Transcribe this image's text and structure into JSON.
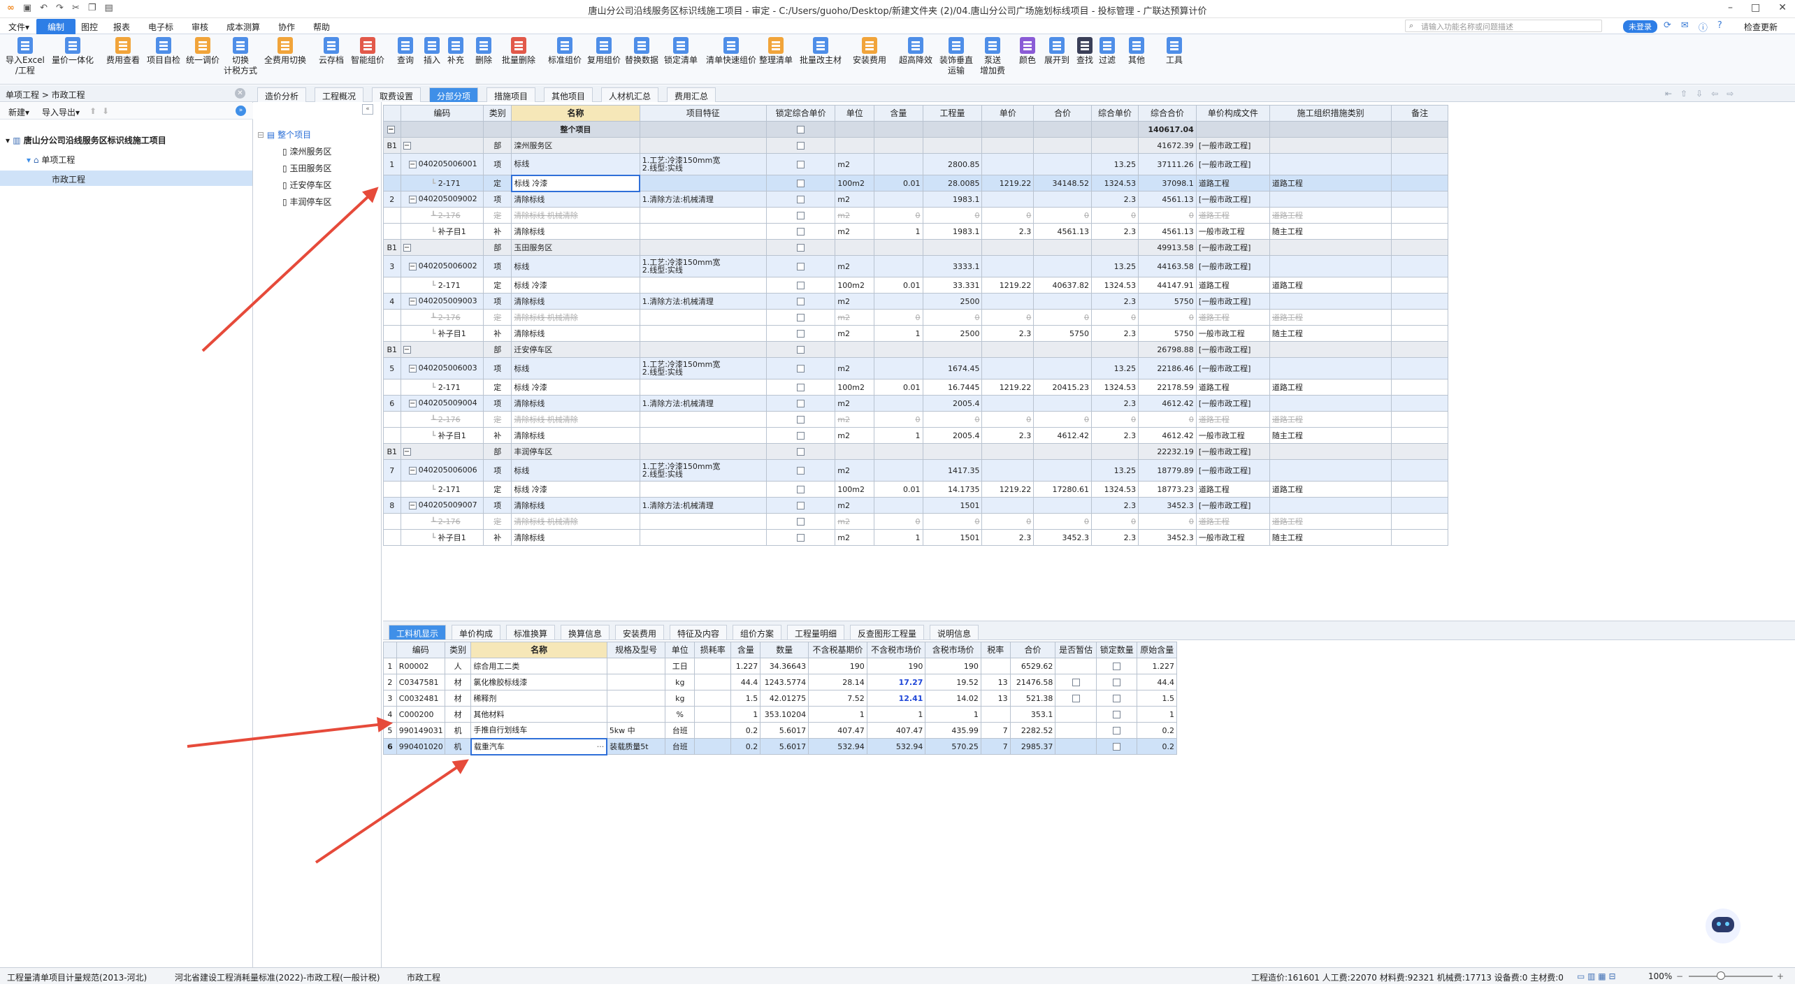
{
  "window": {
    "title": "唐山分公司沿线服务区标识线施工项目 - 审定 - C:/Users/guoho/Desktop/新建文件夹 (2)/04.唐山分公司广场施划标线项目 - 投标管理 - 广联达预算计价",
    "controls": [
      "–",
      "□",
      "✕"
    ]
  },
  "menu": {
    "items": [
      "文件▾",
      "编制",
      "图控",
      "报表",
      "电子标",
      "审核",
      "成本测算",
      "协作",
      "帮助"
    ],
    "active": "编制",
    "search_placeholder": "请输入功能名称或问题描述",
    "login": "未登录",
    "check_update": "检查更新"
  },
  "ribbon": [
    {
      "l1": "导入Excel",
      "l2": "/工程",
      "c": ""
    },
    {
      "l1": "量价一体化",
      "l2": "",
      "c": ""
    },
    {
      "l1": "费用查看",
      "l2": "",
      "c": "o"
    },
    {
      "l1": "项目自检",
      "l2": "",
      "c": ""
    },
    {
      "l1": "统一调价",
      "l2": "",
      "c": "o"
    },
    {
      "l1": "切换",
      "l2": "计税方式",
      "c": ""
    },
    {
      "l1": "全费用切换",
      "l2": "",
      "c": "o"
    },
    {
      "l1": "云存档",
      "l2": "",
      "c": ""
    },
    {
      "l1": "智能组价",
      "l2": "",
      "c": "r"
    },
    {
      "l1": "查询",
      "l2": "",
      "c": ""
    },
    {
      "l1": "插入",
      "l2": "",
      "c": ""
    },
    {
      "l1": "补充",
      "l2": "",
      "c": ""
    },
    {
      "l1": "删除",
      "l2": "",
      "c": ""
    },
    {
      "l1": "批量删除",
      "l2": "",
      "c": "r"
    },
    {
      "l1": "标准组价",
      "l2": "",
      "c": ""
    },
    {
      "l1": "复用组价",
      "l2": "",
      "c": ""
    },
    {
      "l1": "替换数据",
      "l2": "",
      "c": ""
    },
    {
      "l1": "锁定清单",
      "l2": "",
      "c": ""
    },
    {
      "l1": "清单快速组价",
      "l2": "",
      "c": ""
    },
    {
      "l1": "整理清单",
      "l2": "",
      "c": "o"
    },
    {
      "l1": "批量改主材",
      "l2": "",
      "c": ""
    },
    {
      "l1": "安装费用",
      "l2": "",
      "c": "o"
    },
    {
      "l1": "超高降效",
      "l2": "",
      "c": ""
    },
    {
      "l1": "装饰垂直",
      "l2": "运输",
      "c": ""
    },
    {
      "l1": "泵送",
      "l2": "增加费",
      "c": ""
    },
    {
      "l1": "颜色",
      "l2": "",
      "c": "p"
    },
    {
      "l1": "展开到",
      "l2": "",
      "c": ""
    },
    {
      "l1": "查找",
      "l2": "",
      "c": "k"
    },
    {
      "l1": "过滤",
      "l2": "",
      "c": ""
    },
    {
      "l1": "其他",
      "l2": "",
      "c": ""
    },
    {
      "l1": "工具",
      "l2": "",
      "c": ""
    }
  ],
  "left_panel": {
    "breadcrumb": "单项工程 > 市政工程",
    "close": "✕",
    "new_label": "新建▾",
    "import_label": "导入导出▾",
    "tree": [
      {
        "label": "唐山分公司沿线服务区标识线施工项目",
        "level": 0,
        "selected": false
      },
      {
        "label": "单项工程",
        "level": 1,
        "selected": false
      },
      {
        "label": "市政工程",
        "level": 2,
        "selected": true
      }
    ]
  },
  "sub_tree": {
    "root": "整个项目",
    "items": [
      "滦州服务区",
      "玉田服务区",
      "迁安停车区",
      "丰润停车区"
    ]
  },
  "tabs": {
    "items": [
      "造价分析",
      "工程概况",
      "取费设置",
      "分部分项",
      "措施项目",
      "其他项目",
      "人材机汇总",
      "费用汇总"
    ],
    "active": "分部分项"
  },
  "main_table": {
    "columns": [
      "",
      "编码",
      "类别",
      "名称",
      "项目特征",
      "锁定综合单价",
      "单位",
      "含量",
      "工程量",
      "单价",
      "合价",
      "综合单价",
      "综合合价",
      "单价构成文件",
      "施工组织措施类别",
      "备注"
    ],
    "rows": [
      {
        "t": "sum",
        "no": "",
        "code": "",
        "type": "",
        "name": "整个项目",
        "feat": "",
        "unit": "",
        "qty": "",
        "amount": "",
        "price": "",
        "total": "",
        "uprice": "",
        "utotal": "140617.04",
        "file": "",
        "cat": ""
      },
      {
        "t": "bu",
        "no": "B1",
        "code": "",
        "type": "部",
        "name": "滦州服务区",
        "feat": "",
        "unit": "",
        "qty": "",
        "amount": "",
        "price": "",
        "total": "",
        "uprice": "",
        "utotal": "41672.39",
        "file": "[一般市政工程]",
        "cat": ""
      },
      {
        "t": "qi",
        "no": "1",
        "code": "040205006001",
        "type": "项",
        "name": "标线",
        "feat": "1.工艺:冷漆150mm宽\n2.线型:实线",
        "unit": "m2",
        "qty": "",
        "amount": "2800.85",
        "price": "",
        "total": "",
        "uprice": "13.25",
        "utotal": "37111.26",
        "file": "[一般市政工程]",
        "cat": ""
      },
      {
        "t": "cur",
        "no": "",
        "code": "2-171",
        "type": "定",
        "name": "标线 冷漆",
        "feat": "",
        "unit": "100m2",
        "qty": "0.01",
        "amount": "28.0085",
        "price": "1219.22",
        "total": "34148.52",
        "uprice": "1324.53",
        "utotal": "37098.1",
        "file": "道路工程",
        "cat": "道路工程"
      },
      {
        "t": "qi",
        "no": "2",
        "code": "040205009002",
        "type": "项",
        "name": "清除标线",
        "feat": "1.清除方法:机械清理",
        "unit": "m2",
        "qty": "",
        "amount": "1983.1",
        "price": "",
        "total": "",
        "uprice": "2.3",
        "utotal": "4561.13",
        "file": "[一般市政工程]",
        "cat": ""
      },
      {
        "t": "del",
        "no": "",
        "code": "2-176",
        "type": "定",
        "name": "清除标线 机械清除",
        "feat": "",
        "unit": "m2",
        "qty": "0",
        "amount": "0",
        "price": "0",
        "total": "0",
        "uprice": "0",
        "utotal": "0",
        "file": "道路工程",
        "cat": "道路工程"
      },
      {
        "t": "de",
        "no": "",
        "code": "补子目1",
        "type": "补",
        "name": "清除标线",
        "feat": "",
        "unit": "m2",
        "qty": "1",
        "amount": "1983.1",
        "price": "2.3",
        "total": "4561.13",
        "uprice": "2.3",
        "utotal": "4561.13",
        "file": "一般市政工程",
        "cat": "随主工程"
      },
      {
        "t": "bu",
        "no": "B1",
        "code": "",
        "type": "部",
        "name": "玉田服务区",
        "feat": "",
        "unit": "",
        "qty": "",
        "amount": "",
        "price": "",
        "total": "",
        "uprice": "",
        "utotal": "49913.58",
        "file": "[一般市政工程]",
        "cat": ""
      },
      {
        "t": "qi",
        "no": "3",
        "code": "040205006002",
        "type": "项",
        "name": "标线",
        "feat": "1.工艺:冷漆150mm宽\n2.线型:实线",
        "unit": "m2",
        "qty": "",
        "amount": "3333.1",
        "price": "",
        "total": "",
        "uprice": "13.25",
        "utotal": "44163.58",
        "file": "[一般市政工程]",
        "cat": ""
      },
      {
        "t": "de",
        "no": "",
        "code": "2-171",
        "type": "定",
        "name": "标线 冷漆",
        "feat": "",
        "unit": "100m2",
        "qty": "0.01",
        "amount": "33.331",
        "price": "1219.22",
        "total": "40637.82",
        "uprice": "1324.53",
        "utotal": "44147.91",
        "file": "道路工程",
        "cat": "道路工程"
      },
      {
        "t": "qi",
        "no": "4",
        "code": "040205009003",
        "type": "项",
        "name": "清除标线",
        "feat": "1.清除方法:机械清理",
        "unit": "m2",
        "qty": "",
        "amount": "2500",
        "price": "",
        "total": "",
        "uprice": "2.3",
        "utotal": "5750",
        "file": "[一般市政工程]",
        "cat": ""
      },
      {
        "t": "del",
        "no": "",
        "code": "2-176",
        "type": "定",
        "name": "清除标线 机械清除",
        "feat": "",
        "unit": "m2",
        "qty": "0",
        "amount": "0",
        "price": "0",
        "total": "0",
        "uprice": "0",
        "utotal": "0",
        "file": "道路工程",
        "cat": "道路工程"
      },
      {
        "t": "de",
        "no": "",
        "code": "补子目1",
        "type": "补",
        "name": "清除标线",
        "feat": "",
        "unit": "m2",
        "qty": "1",
        "amount": "2500",
        "price": "2.3",
        "total": "5750",
        "uprice": "2.3",
        "utotal": "5750",
        "file": "一般市政工程",
        "cat": "随主工程"
      },
      {
        "t": "bu",
        "no": "B1",
        "code": "",
        "type": "部",
        "name": "迁安停车区",
        "feat": "",
        "unit": "",
        "qty": "",
        "amount": "",
        "price": "",
        "total": "",
        "uprice": "",
        "utotal": "26798.88",
        "file": "[一般市政工程]",
        "cat": ""
      },
      {
        "t": "qi",
        "no": "5",
        "code": "040205006003",
        "type": "项",
        "name": "标线",
        "feat": "1.工艺:冷漆150mm宽\n2.线型:实线",
        "unit": "m2",
        "qty": "",
        "amount": "1674.45",
        "price": "",
        "total": "",
        "uprice": "13.25",
        "utotal": "22186.46",
        "file": "[一般市政工程]",
        "cat": ""
      },
      {
        "t": "de",
        "no": "",
        "code": "2-171",
        "type": "定",
        "name": "标线 冷漆",
        "feat": "",
        "unit": "100m2",
        "qty": "0.01",
        "amount": "16.7445",
        "price": "1219.22",
        "total": "20415.23",
        "uprice": "1324.53",
        "utotal": "22178.59",
        "file": "道路工程",
        "cat": "道路工程"
      },
      {
        "t": "qi",
        "no": "6",
        "code": "040205009004",
        "type": "项",
        "name": "清除标线",
        "feat": "1.清除方法:机械清理",
        "unit": "m2",
        "qty": "",
        "amount": "2005.4",
        "price": "",
        "total": "",
        "uprice": "2.3",
        "utotal": "4612.42",
        "file": "[一般市政工程]",
        "cat": ""
      },
      {
        "t": "del",
        "no": "",
        "code": "2-176",
        "type": "定",
        "name": "清除标线 机械清除",
        "feat": "",
        "unit": "m2",
        "qty": "0",
        "amount": "0",
        "price": "0",
        "total": "0",
        "uprice": "0",
        "utotal": "0",
        "file": "道路工程",
        "cat": "道路工程"
      },
      {
        "t": "de",
        "no": "",
        "code": "补子目1",
        "type": "补",
        "name": "清除标线",
        "feat": "",
        "unit": "m2",
        "qty": "1",
        "amount": "2005.4",
        "price": "2.3",
        "total": "4612.42",
        "uprice": "2.3",
        "utotal": "4612.42",
        "file": "一般市政工程",
        "cat": "随主工程"
      },
      {
        "t": "bu",
        "no": "B1",
        "code": "",
        "type": "部",
        "name": "丰润停车区",
        "feat": "",
        "unit": "",
        "qty": "",
        "amount": "",
        "price": "",
        "total": "",
        "uprice": "",
        "utotal": "22232.19",
        "file": "[一般市政工程]",
        "cat": ""
      },
      {
        "t": "qi",
        "no": "7",
        "code": "040205006006",
        "type": "项",
        "name": "标线",
        "feat": "1.工艺:冷漆150mm宽\n2.线型:实线",
        "unit": "m2",
        "qty": "",
        "amount": "1417.35",
        "price": "",
        "total": "",
        "uprice": "13.25",
        "utotal": "18779.89",
        "file": "[一般市政工程]",
        "cat": ""
      },
      {
        "t": "de",
        "no": "",
        "code": "2-171",
        "type": "定",
        "name": "标线 冷漆",
        "feat": "",
        "unit": "100m2",
        "qty": "0.01",
        "amount": "14.1735",
        "price": "1219.22",
        "total": "17280.61",
        "uprice": "1324.53",
        "utotal": "18773.23",
        "file": "道路工程",
        "cat": "道路工程"
      },
      {
        "t": "qi",
        "no": "8",
        "code": "040205009007",
        "type": "项",
        "name": "清除标线",
        "feat": "1.清除方法:机械清理",
        "unit": "m2",
        "qty": "",
        "amount": "1501",
        "price": "",
        "total": "",
        "uprice": "2.3",
        "utotal": "3452.3",
        "file": "[一般市政工程]",
        "cat": ""
      },
      {
        "t": "del",
        "no": "",
        "code": "2-176",
        "type": "定",
        "name": "清除标线 机械清除",
        "feat": "",
        "unit": "m2",
        "qty": "0",
        "amount": "0",
        "price": "0",
        "total": "0",
        "uprice": "0",
        "utotal": "0",
        "file": "道路工程",
        "cat": "道路工程"
      },
      {
        "t": "de",
        "no": "",
        "code": "补子目1",
        "type": "补",
        "name": "清除标线",
        "feat": "",
        "unit": "m2",
        "qty": "1",
        "amount": "1501",
        "price": "2.3",
        "total": "3452.3",
        "uprice": "2.3",
        "utotal": "3452.3",
        "file": "一般市政工程",
        "cat": "随主工程"
      }
    ]
  },
  "bottom_tabs": {
    "items": [
      "工料机显示",
      "单价构成",
      "标准换算",
      "换算信息",
      "安装费用",
      "特征及内容",
      "组价方案",
      "工程量明细",
      "反查图形工程量",
      "说明信息"
    ],
    "active": "工料机显示"
  },
  "bottom_table": {
    "columns": [
      "",
      "编码",
      "类别",
      "名称",
      "规格及型号",
      "单位",
      "损耗率",
      "含量",
      "数量",
      "不含税基期价",
      "不含税市场价",
      "含税市场价",
      "税率",
      "合价",
      "是否暂估",
      "锁定数量",
      "原始含量"
    ],
    "rows": [
      {
        "no": "1",
        "code": "R00002",
        "type": "人",
        "name": "综合用工二类",
        "spec": "",
        "unit": "工日",
        "loss": "",
        "qty": "1.227",
        "num": "34.36643",
        "base": "190",
        "mkt": "190",
        "mkt_tax": "190",
        "tax": "",
        "total": "6529.62",
        "est": false,
        "lock": true,
        "orig": "1.227",
        "hl": false,
        "cur": false
      },
      {
        "no": "2",
        "code": "C0347581",
        "type": "材",
        "name": "氯化橡胶标线漆",
        "spec": "",
        "unit": "kg",
        "loss": "",
        "qty": "44.4",
        "num": "1243.5774",
        "base": "28.14",
        "mkt": "17.27",
        "mkt_tax": "19.52",
        "tax": "13",
        "total": "21476.58",
        "est": true,
        "lock": true,
        "orig": "44.4",
        "hl": true,
        "cur": false
      },
      {
        "no": "3",
        "code": "C0032481",
        "type": "材",
        "name": "稀释剂",
        "spec": "",
        "unit": "kg",
        "loss": "",
        "qty": "1.5",
        "num": "42.01275",
        "base": "7.52",
        "mkt": "12.41",
        "mkt_tax": "14.02",
        "tax": "13",
        "total": "521.38",
        "est": true,
        "lock": true,
        "orig": "1.5",
        "hl": true,
        "cur": false
      },
      {
        "no": "4",
        "code": "C000200",
        "type": "材",
        "name": "其他材料",
        "spec": "",
        "unit": "%",
        "loss": "",
        "qty": "1",
        "num": "353.10204",
        "base": "1",
        "mkt": "1",
        "mkt_tax": "1",
        "tax": "",
        "total": "353.1",
        "est": false,
        "lock": true,
        "orig": "1",
        "hl": false,
        "cur": false
      },
      {
        "no": "5",
        "code": "990149031",
        "type": "机",
        "name": "手推自行划线车",
        "spec": "5kw 中",
        "unit": "台班",
        "loss": "",
        "qty": "0.2",
        "num": "5.6017",
        "base": "407.47",
        "mkt": "407.47",
        "mkt_tax": "435.99",
        "tax": "7",
        "total": "2282.52",
        "est": false,
        "lock": true,
        "orig": "0.2",
        "hl": false,
        "cur": false
      },
      {
        "no": "6",
        "code": "990401020",
        "type": "机",
        "name": "载重汽车",
        "spec": "装载质量5t",
        "unit": "台班",
        "loss": "",
        "qty": "0.2",
        "num": "5.6017",
        "base": "532.94",
        "mkt": "532.94",
        "mkt_tax": "570.25",
        "tax": "7",
        "total": "2985.37",
        "est": false,
        "lock": true,
        "orig": "0.2",
        "hl": false,
        "cur": true
      }
    ]
  },
  "status": {
    "std1": "工程量清单项目计量规范(2013-河北)",
    "std2": "河北省建设工程消耗量标准(2022)-市政工程(一般计税)",
    "proj": "市政工程",
    "summary": "工程造价:161601  人工费:22070  材料费:92321  机械费:17713  设备费:0  主材费:0",
    "zoom": "100%"
  }
}
